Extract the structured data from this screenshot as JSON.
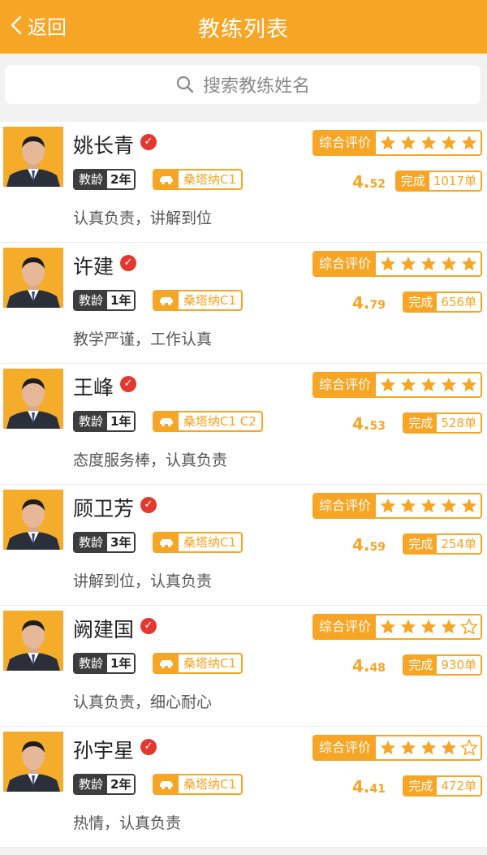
{
  "header": {
    "back_label": "返回",
    "title": "教练列表",
    "background": "#f7a524"
  },
  "search": {
    "placeholder": "搜索教练姓名",
    "icon": "search-icon"
  },
  "coaches": [
    {
      "name": "姚长青",
      "age_label": "教龄",
      "age": "2年",
      "car": "桑塔纳C1",
      "rating_label": "综合评价",
      "stars": 5,
      "score_int": "4.",
      "score_dec": "52",
      "done_label": "完成",
      "done": "1017单",
      "motto": "认真负责，讲解到位"
    },
    {
      "name": "许建",
      "age_label": "教龄",
      "age": "1年",
      "car": "桑塔纳C1",
      "rating_label": "综合评价",
      "stars": 5,
      "score_int": "4.",
      "score_dec": "79",
      "done_label": "完成",
      "done": "656单",
      "motto": "教学严谨，工作认真"
    },
    {
      "name": "王峰",
      "age_label": "教龄",
      "age": "1年",
      "car": "桑塔纳C1 C2",
      "rating_label": "综合评价",
      "stars": 5,
      "score_int": "4.",
      "score_dec": "53",
      "done_label": "完成",
      "done": "528单",
      "motto": "态度服务棒，认真负责"
    },
    {
      "name": "顾卫芳",
      "age_label": "教龄",
      "age": "3年",
      "car": "桑塔纳C1",
      "rating_label": "综合评价",
      "stars": 5,
      "score_int": "4.",
      "score_dec": "59",
      "done_label": "完成",
      "done": "254单",
      "motto": "讲解到位，认真负责"
    },
    {
      "name": "阙建国",
      "age_label": "教龄",
      "age": "1年",
      "car": "桑塔纳C1",
      "rating_label": "综合评价",
      "stars": 4,
      "score_int": "4.",
      "score_dec": "48",
      "done_label": "完成",
      "done": "930单",
      "motto": "认真负责，细心耐心"
    },
    {
      "name": "孙宇星",
      "age_label": "教龄",
      "age": "2年",
      "car": "桑塔纳C1",
      "rating_label": "综合评价",
      "stars": 4,
      "score_int": "4.",
      "score_dec": "41",
      "done_label": "完成",
      "done": "472单",
      "motto": "热情，认真负责"
    }
  ],
  "colors": {
    "accent": "#f7a524",
    "verified": "#e3382f",
    "dark_tag": "#3d3d3d"
  }
}
